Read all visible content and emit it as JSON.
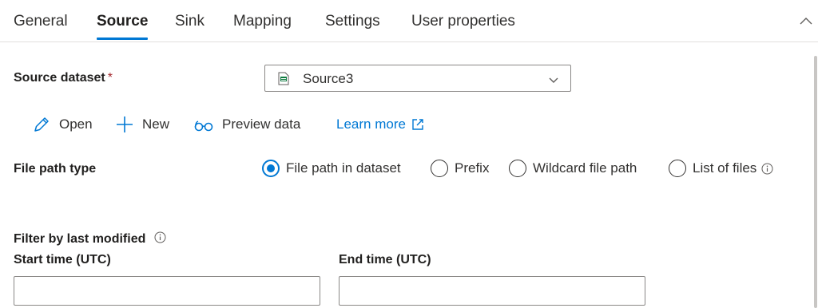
{
  "tabs": [
    {
      "label": "General"
    },
    {
      "label": "Source"
    },
    {
      "label": "Sink"
    },
    {
      "label": "Mapping"
    },
    {
      "label": "Settings"
    },
    {
      "label": "User properties"
    }
  ],
  "active_tab": "Source",
  "source_dataset": {
    "label": "Source dataset",
    "required_mark": "*",
    "selected": "Source3",
    "icon": "csv-file-icon"
  },
  "actions": {
    "open": "Open",
    "new": "New",
    "preview": "Preview data",
    "learn_more": "Learn more"
  },
  "file_path_type": {
    "label": "File path type",
    "options": [
      {
        "label": "File path in dataset",
        "selected": true
      },
      {
        "label": "Prefix",
        "selected": false
      },
      {
        "label": "Wildcard file path",
        "selected": false
      },
      {
        "label": "List of files",
        "selected": false
      }
    ]
  },
  "filter": {
    "label": "Filter by last modified",
    "start_label": "Start time (UTC)",
    "end_label": "End time (UTC)",
    "start_value": "",
    "end_value": ""
  },
  "colors": {
    "accent": "#0078d4",
    "required": "#a4262c",
    "text": "#323130"
  }
}
